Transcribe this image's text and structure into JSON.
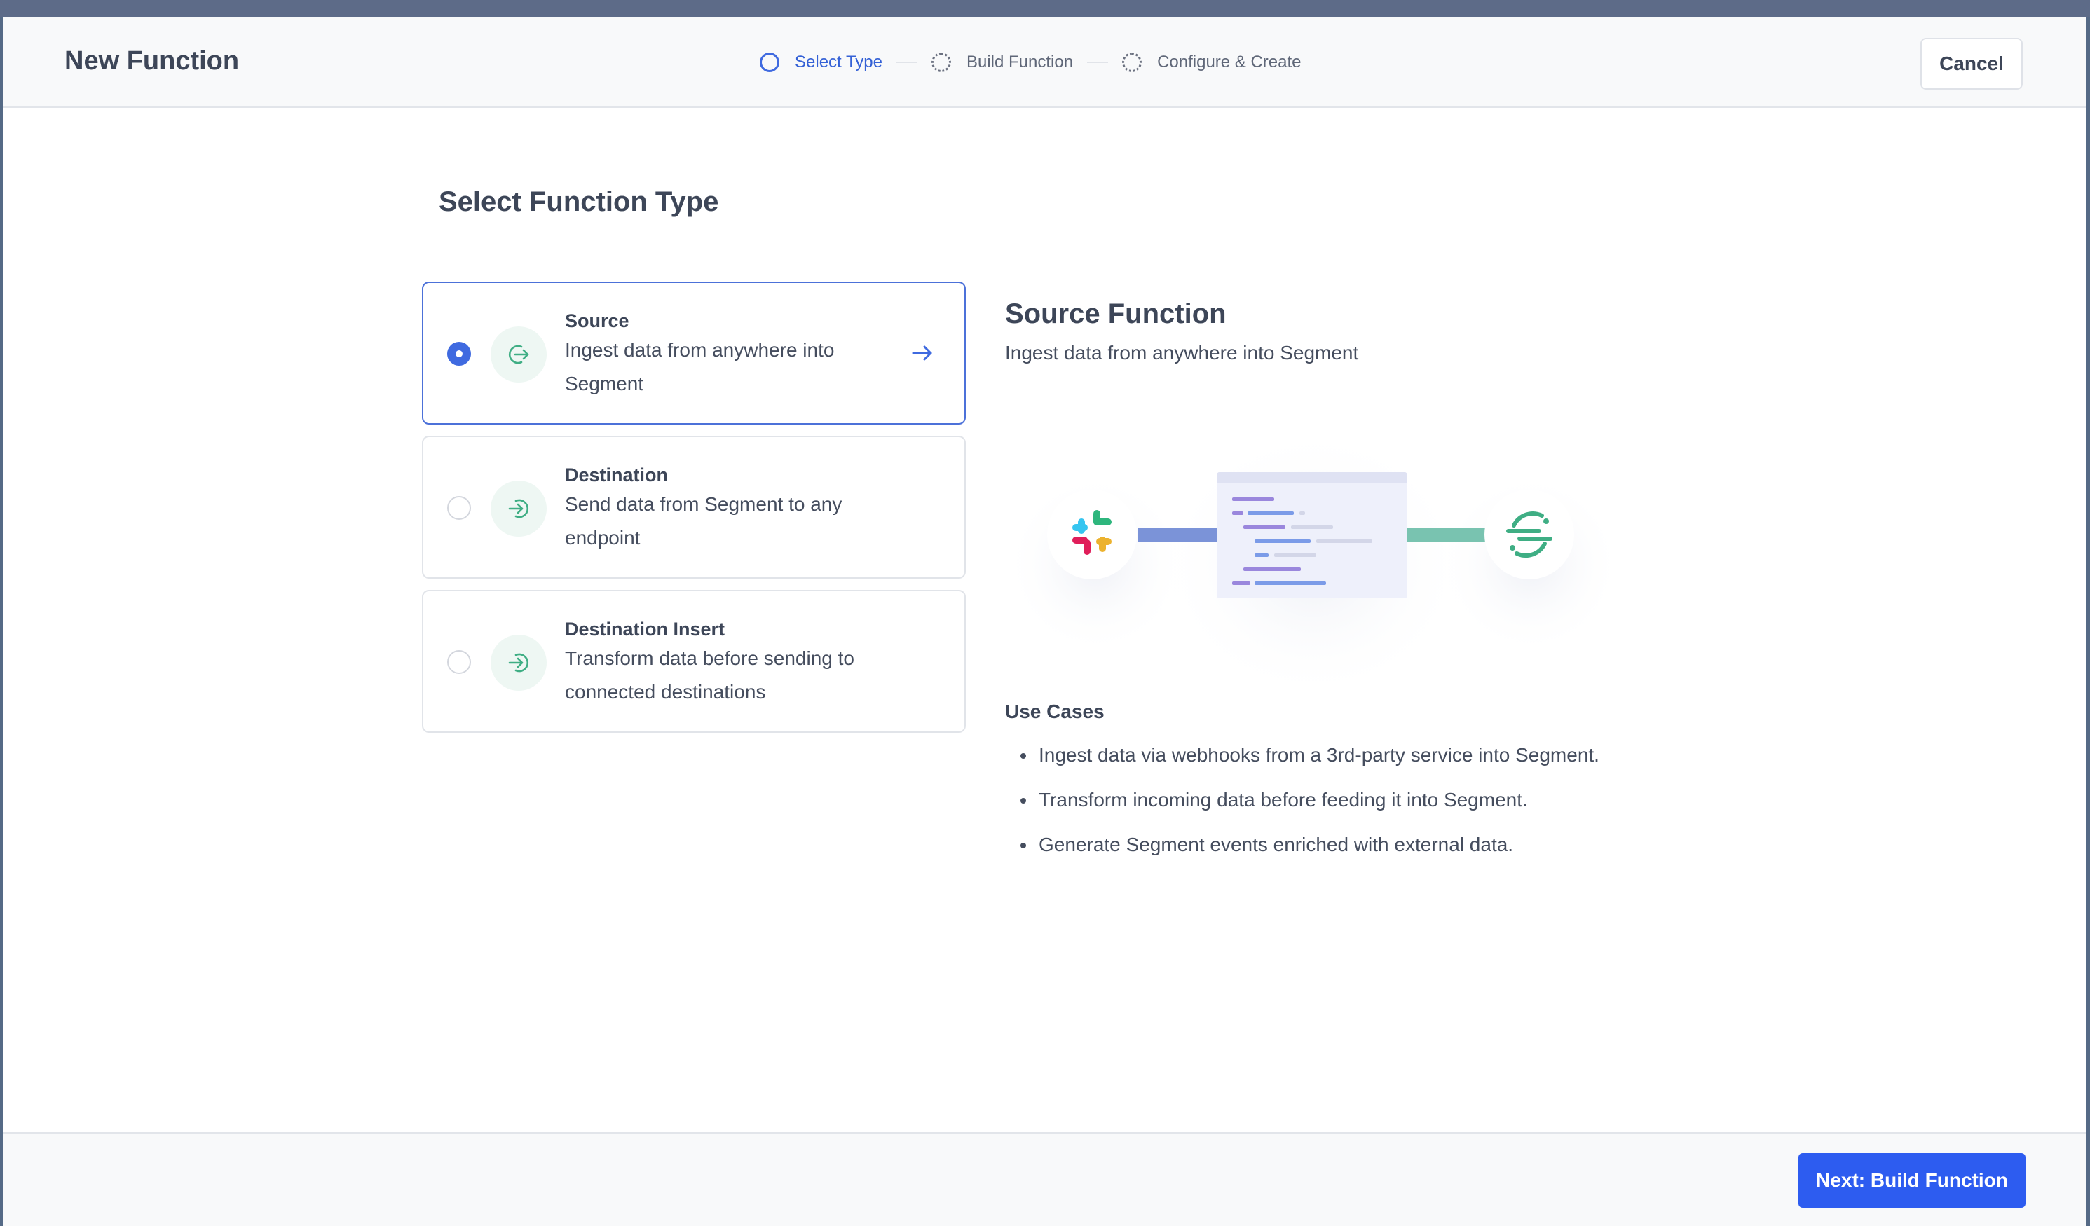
{
  "header": {
    "title": "New Function",
    "steps": [
      {
        "label": "Select Type",
        "state": "active"
      },
      {
        "label": "Build Function",
        "state": "pending"
      },
      {
        "label": "Configure & Create",
        "state": "pending"
      }
    ],
    "cancel_label": "Cancel"
  },
  "main": {
    "section_title": "Select Function Type",
    "options": [
      {
        "label": "Source",
        "description": "Ingest data from anywhere into Segment",
        "selected": true,
        "icon": "source-arrow-icon"
      },
      {
        "label": "Destination",
        "description": "Send data from Segment to any endpoint",
        "selected": false,
        "icon": "destination-arrow-icon"
      },
      {
        "label": "Destination Insert",
        "description": "Transform data before sending to connected destinations",
        "selected": false,
        "icon": "destination-insert-arrow-icon"
      }
    ]
  },
  "detail": {
    "title": "Source Function",
    "subtitle": "Ingest data from anywhere into Segment",
    "illustration_icons": [
      "slack-logo-icon",
      "code-editor-icon",
      "segment-logo-icon"
    ],
    "use_cases_title": "Use Cases",
    "use_cases": [
      "Ingest data via webhooks from a 3rd-party service into Segment.",
      "Transform incoming data before feeding it into Segment.",
      "Generate Segment events enriched with external data."
    ]
  },
  "footer": {
    "next_label": "Next: Build Function"
  },
  "colors": {
    "accent": "#2d5cf0",
    "active_step": "#3461d6",
    "icon_green": "#3fae84"
  }
}
